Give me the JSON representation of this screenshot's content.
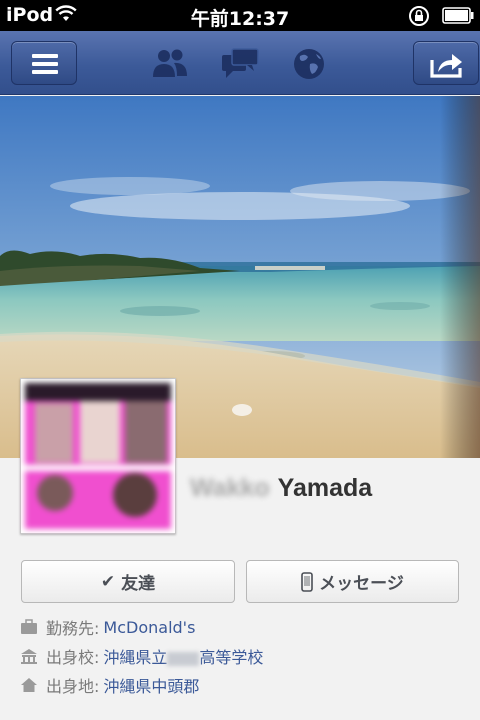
{
  "status_bar": {
    "carrier": "iPod",
    "time": "午前12:37"
  },
  "nav": {
    "icons": [
      "menu-icon",
      "friends-icon",
      "messages-icon",
      "globe-icon",
      "share-icon"
    ]
  },
  "profile": {
    "name_first": "Wakko",
    "name_last": "Yamada"
  },
  "actions": {
    "friends_label": "友達",
    "message_label": "メッセージ"
  },
  "info": {
    "work_label": "勤務先:",
    "work_value": "McDonald's",
    "school_label": "出身校:",
    "school_value_pre": "沖縄県立",
    "school_value_post": "高等学校",
    "hometown_label": "出身地:",
    "hometown_value": "沖縄県中頭郡"
  },
  "colors": {
    "nav_blue": "#3c5a99",
    "link_blue": "#3b5998"
  }
}
